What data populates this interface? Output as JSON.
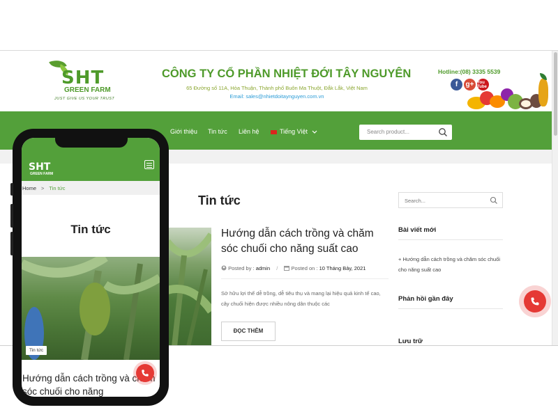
{
  "header": {
    "logo_text": "SHT",
    "logo_sub": "GREEN FARM",
    "logo_tagline": "JUST GIVE US YOUR TRUST",
    "company_name": "CÔNG TY CỔ PHẦN NHIỆT ĐỚI TÂY NGUYÊN",
    "address": "65 Đường số 11A, Hòa Thuận, Thành phố Buôn Ma Thuột, Đắk Lắk, Việt Nam",
    "email": "Email: sales@nhietdoitaynguyen.com.vn",
    "hotline": "Hotline:(08) 3335 5539",
    "social": [
      {
        "icon": "facebook-icon",
        "glyph": "f"
      },
      {
        "icon": "google-plus-icon",
        "glyph": "g+"
      },
      {
        "icon": "youtube-icon",
        "glyph": "You Tube"
      }
    ]
  },
  "nav": {
    "items": [
      "Giới thiệu",
      "Tin tức",
      "Liên hệ"
    ],
    "language": "Tiếng Việt",
    "search_placeholder": "Search product..."
  },
  "main": {
    "page_title": "Tin tức",
    "post": {
      "title": "Hướng dẫn cách trồng và chăm sóc chuối cho năng suất cao",
      "posted_by_label": "Posted by :",
      "author": "admin",
      "posted_on_label": "Posted on :",
      "date": "10 Tháng Bảy, 2021",
      "excerpt": "Sở hữu lợi thế dễ trồng, dễ tiêu thụ và mang lại hiệu quả kinh tế cao, cây chuối hiện được nhiều nông dân thuộc các",
      "read_more": "ĐỌC THÊM"
    }
  },
  "sidebar": {
    "search_placeholder": "Search...",
    "recent_posts_heading": "Bài viết mới",
    "recent_post": "Hướng dẫn cách trồng và chăm sóc chuối cho năng suất cao",
    "recent_comments_heading": "Phản hồi gần đây",
    "archives_heading": "Lưu trữ"
  },
  "mobile": {
    "logo_text": "SHT",
    "logo_sub": "GREEN FARM",
    "breadcrumb_home": "Home",
    "breadcrumb_sep": ">",
    "breadcrumb_current": "Tin tức",
    "page_title": "Tin tức",
    "category_tag": "Tin tức",
    "post_title": "Hướng dẫn cách trồng và chăm sóc chuối cho năng"
  },
  "colors": {
    "brand_green": "#53a03a",
    "call_red": "#e53935"
  }
}
